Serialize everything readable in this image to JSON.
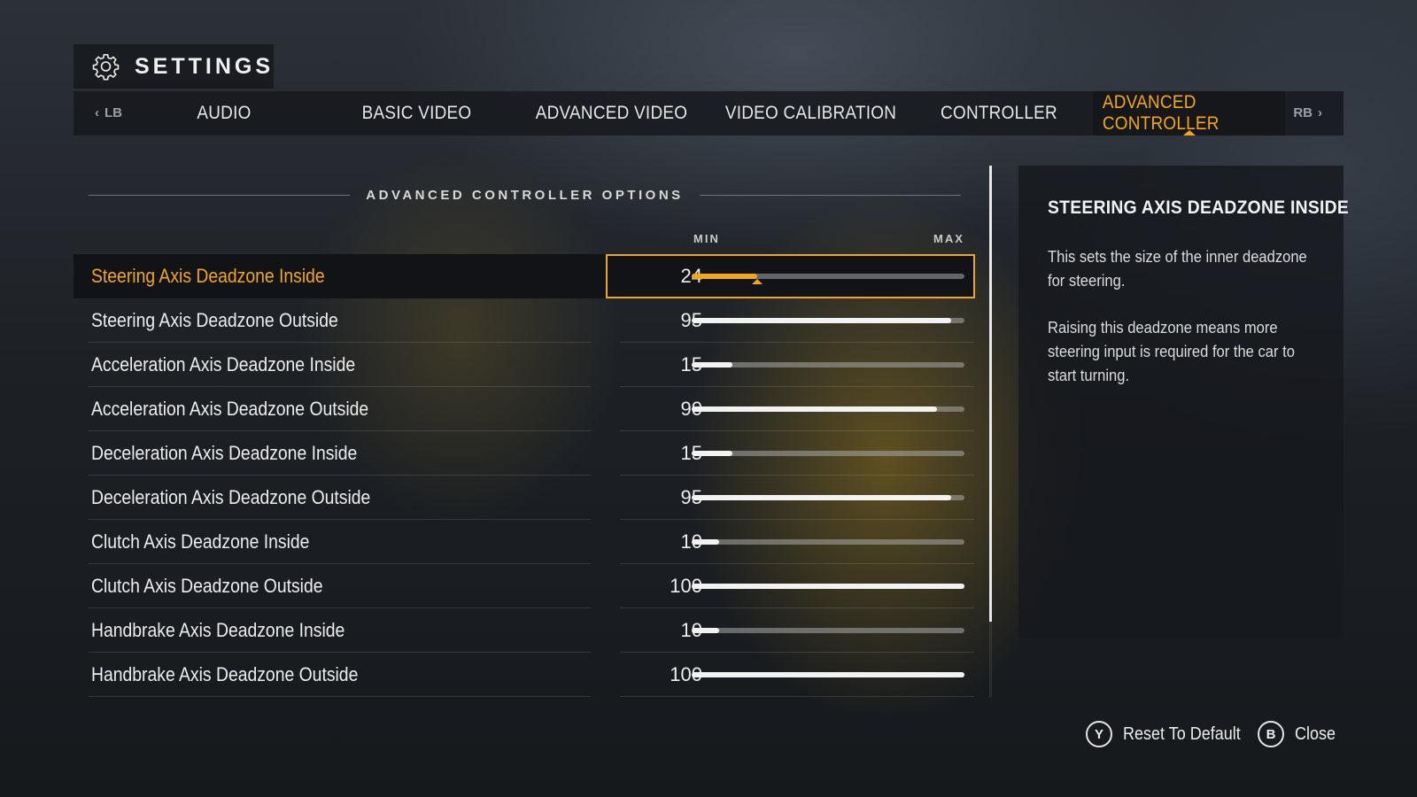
{
  "header": {
    "title": "SETTINGS",
    "icon": "gear-icon"
  },
  "tabs": {
    "prev_bumper": "LB",
    "next_bumper": "RB",
    "items": [
      {
        "label": "AUDIO",
        "active": false
      },
      {
        "label": "BASIC VIDEO",
        "active": false
      },
      {
        "label": "ADVANCED VIDEO",
        "active": false
      },
      {
        "label": "VIDEO CALIBRATION",
        "active": false
      },
      {
        "label": "CONTROLLER",
        "active": false
      },
      {
        "label": "ADVANCED CONTROLLER",
        "active": true
      }
    ]
  },
  "section": {
    "title": "ADVANCED CONTROLLER OPTIONS",
    "min_label": "MIN",
    "max_label": "MAX",
    "slider_max": 100,
    "options": [
      {
        "label": "Steering Axis Deadzone Inside",
        "value": "24",
        "selected": true
      },
      {
        "label": "Steering Axis Deadzone Outside",
        "value": "95"
      },
      {
        "label": "Acceleration Axis Deadzone Inside",
        "value": "15"
      },
      {
        "label": "Acceleration Axis Deadzone Outside",
        "value": "90"
      },
      {
        "label": "Deceleration Axis Deadzone Inside",
        "value": "15"
      },
      {
        "label": "Deceleration Axis Deadzone Outside",
        "value": "95"
      },
      {
        "label": "Clutch Axis Deadzone Inside",
        "value": "10"
      },
      {
        "label": "Clutch Axis Deadzone Outside",
        "value": "100"
      },
      {
        "label": "Handbrake Axis Deadzone Inside",
        "value": "10"
      },
      {
        "label": "Handbrake Axis Deadzone Outside",
        "value": "100"
      }
    ]
  },
  "description": {
    "title": "STEERING AXIS DEADZONE INSIDE",
    "paragraphs": [
      "This sets the size of the inner deadzone for steering.",
      "Raising this deadzone means more steering input is required for the car to start turning."
    ]
  },
  "footer": {
    "reset": {
      "button": "Y",
      "label": "Reset To Default"
    },
    "close": {
      "button": "B",
      "label": "Close"
    }
  },
  "colors": {
    "accent": "#f3a716",
    "text": "#ededed",
    "panel": "#16191d"
  }
}
